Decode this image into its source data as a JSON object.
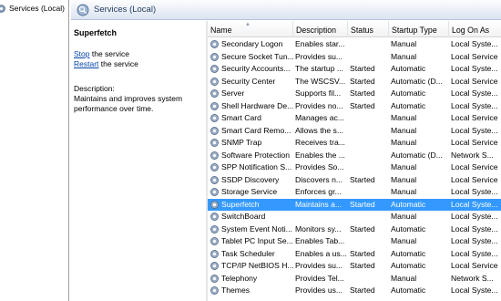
{
  "tree": {
    "root_label": "Services (Local)"
  },
  "header": {
    "title": "Services (Local)"
  },
  "details": {
    "service_name": "Superfetch",
    "stop_link": "Stop",
    "stop_suffix": " the service",
    "restart_link": "Restart",
    "restart_suffix": " the service",
    "description_label": "Description:",
    "description_text": "Maintains and improves system performance over time."
  },
  "columns": [
    "Name",
    "Description",
    "Status",
    "Startup Type",
    "Log On As"
  ],
  "rows": [
    {
      "name": "Secondary Logon",
      "desc": "Enables star...",
      "status": "",
      "startup": "Manual",
      "logon": "Local Syste..."
    },
    {
      "name": "Secure Socket Tun...",
      "desc": "Provides su...",
      "status": "",
      "startup": "Manual",
      "logon": "Local Service"
    },
    {
      "name": "Security Accounts...",
      "desc": "The startup ...",
      "status": "Started",
      "startup": "Automatic",
      "logon": "Local Syste..."
    },
    {
      "name": "Security Center",
      "desc": "The WSCSV...",
      "status": "Started",
      "startup": "Automatic (D...",
      "logon": "Local Service"
    },
    {
      "name": "Server",
      "desc": "Supports fil...",
      "status": "Started",
      "startup": "Automatic",
      "logon": "Local Syste..."
    },
    {
      "name": "Shell Hardware De...",
      "desc": "Provides no...",
      "status": "Started",
      "startup": "Automatic",
      "logon": "Local Syste..."
    },
    {
      "name": "Smart Card",
      "desc": "Manages ac...",
      "status": "",
      "startup": "Manual",
      "logon": "Local Service"
    },
    {
      "name": "Smart Card Remo...",
      "desc": "Allows the s...",
      "status": "",
      "startup": "Manual",
      "logon": "Local Syste..."
    },
    {
      "name": "SNMP Trap",
      "desc": "Receives tra...",
      "status": "",
      "startup": "Manual",
      "logon": "Local Service"
    },
    {
      "name": "Software Protection",
      "desc": "Enables the ...",
      "status": "",
      "startup": "Automatic (D...",
      "logon": "Network S..."
    },
    {
      "name": "SPP Notification S...",
      "desc": "Provides So...",
      "status": "",
      "startup": "Manual",
      "logon": "Local Service"
    },
    {
      "name": "SSDP Discovery",
      "desc": "Discovers n...",
      "status": "Started",
      "startup": "Manual",
      "logon": "Local Service"
    },
    {
      "name": "Storage Service",
      "desc": "Enforces gr...",
      "status": "",
      "startup": "Manual",
      "logon": "Local Syste..."
    },
    {
      "name": "Superfetch",
      "desc": "Maintains a...",
      "status": "Started",
      "startup": "Automatic",
      "logon": "Local Syste..."
    },
    {
      "name": "SwitchBoard",
      "desc": "",
      "status": "",
      "startup": "Manual",
      "logon": "Local Syste..."
    },
    {
      "name": "System Event Noti...",
      "desc": "Monitors sy...",
      "status": "Started",
      "startup": "Automatic",
      "logon": "Local Syste..."
    },
    {
      "name": "Tablet PC Input Se...",
      "desc": "Enables Tab...",
      "status": "",
      "startup": "Manual",
      "logon": "Local Syste..."
    },
    {
      "name": "Task Scheduler",
      "desc": "Enables a us...",
      "status": "Started",
      "startup": "Automatic",
      "logon": "Local Syste..."
    },
    {
      "name": "TCP/IP NetBIOS H...",
      "desc": "Provides su...",
      "status": "Started",
      "startup": "Automatic",
      "logon": "Local Service"
    },
    {
      "name": "Telephony",
      "desc": "Provides Tel...",
      "status": "",
      "startup": "Manual",
      "logon": "Network S..."
    },
    {
      "name": "Themes",
      "desc": "Provides us...",
      "status": "Started",
      "startup": "Automatic",
      "logon": "Local Syste..."
    }
  ],
  "selected_row": "Superfetch",
  "colors": {
    "selection": "#3399ff",
    "link": "#0645ad",
    "title_text": "#1e395b"
  },
  "icons": {
    "service": "gear-icon",
    "header": "magnifier-icon"
  }
}
